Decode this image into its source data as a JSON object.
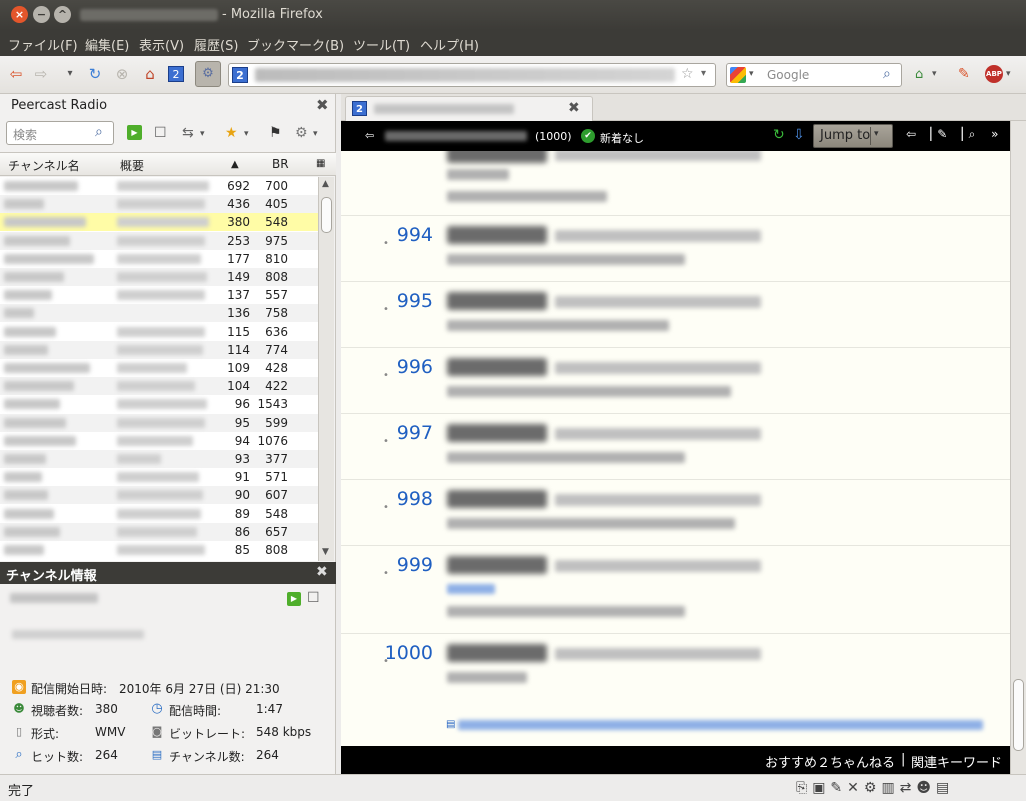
{
  "window": {
    "title_suffix": "- Mozilla Firefox",
    "close": "×",
    "minimize": "−",
    "maximize": "^"
  },
  "menu": [
    "ファイル(F)",
    "編集(E)",
    "表示(V)",
    "履歴(S)",
    "ブックマーク(B)",
    "ツール(T)",
    "ヘルプ(H)"
  ],
  "toolbar": {
    "back": "⇦",
    "forward": "⇨",
    "history_drop": "▾",
    "reload": "↻",
    "stop": "⊗",
    "home": "⌂",
    "tab_icon": "2",
    "url_star": "☆",
    "url_drop": "▾",
    "search_placeholder": "Google",
    "search_icon": "⌕"
  },
  "sidebar": {
    "title": "Peercast Radio",
    "close": "✖",
    "search_placeholder": "検索",
    "search_icon": "⌕",
    "columns": {
      "name": "チャンネル名",
      "desc": "概要",
      "sort": "▲",
      "br": "BR",
      "menu": "▦"
    },
    "rows": [
      {
        "listeners": "692",
        "br": "700"
      },
      {
        "listeners": "436",
        "br": "405"
      },
      {
        "listeners": "380",
        "br": "548"
      },
      {
        "listeners": "253",
        "br": "975"
      },
      {
        "listeners": "177",
        "br": "810"
      },
      {
        "listeners": "149",
        "br": "808"
      },
      {
        "listeners": "137",
        "br": "557"
      },
      {
        "listeners": "136",
        "br": "758"
      },
      {
        "listeners": "115",
        "br": "636"
      },
      {
        "listeners": "114",
        "br": "774"
      },
      {
        "listeners": "109",
        "br": "428"
      },
      {
        "listeners": "104",
        "br": "422"
      },
      {
        "listeners": "96",
        "br": "1543"
      },
      {
        "listeners": "95",
        "br": "599"
      },
      {
        "listeners": "94",
        "br": "1076"
      },
      {
        "listeners": "93",
        "br": "377"
      },
      {
        "listeners": "91",
        "br": "571"
      },
      {
        "listeners": "90",
        "br": "607"
      },
      {
        "listeners": "89",
        "br": "548"
      },
      {
        "listeners": "86",
        "br": "657"
      },
      {
        "listeners": "85",
        "br": "808"
      }
    ]
  },
  "info": {
    "title": "チャンネル情報",
    "close": "✖",
    "start_label": "配信開始日時:",
    "start_value": "2010年 6月 27日 (日) 21:30",
    "listeners_label": "視聴者数:",
    "listeners_value": "380",
    "duration_label": "配信時間:",
    "duration_value": "1:47",
    "format_label": "形式:",
    "format_value": "WMV",
    "bitrate_label": "ビットレート:",
    "bitrate_value": "548 kbps",
    "hits_label": "ヒット数:",
    "hits_value": "264",
    "channels_label": "チャンネル数:",
    "channels_value": "264"
  },
  "tab": {
    "icon": "2",
    "close": "✖"
  },
  "thread": {
    "back": "⇦",
    "count": "(1000)",
    "new_label": "新着なし",
    "new_icon": "✔",
    "jump": "Jump to",
    "jump_drop": "▾",
    "reload": "↻",
    "download": "⇩",
    "icons": "⇦▕✎▕⌕ »",
    "posts": [
      "994",
      "995",
      "996",
      "997",
      "998",
      "999",
      "1000"
    ],
    "footer_recommend": "おすすめ２ちゃんねる",
    "footer_sep": "|",
    "footer_keywords": "関連キーワード",
    "link_icon": "▤"
  },
  "status": {
    "text": "完了",
    "icons": "⎘▣✎✕⚙▥⇄☻▤"
  },
  "colors": {
    "titlebar": "#3c3b37",
    "accent_close": "#e4562b",
    "post_number": "#1f5fc1",
    "selected_row": "#fffca6"
  }
}
